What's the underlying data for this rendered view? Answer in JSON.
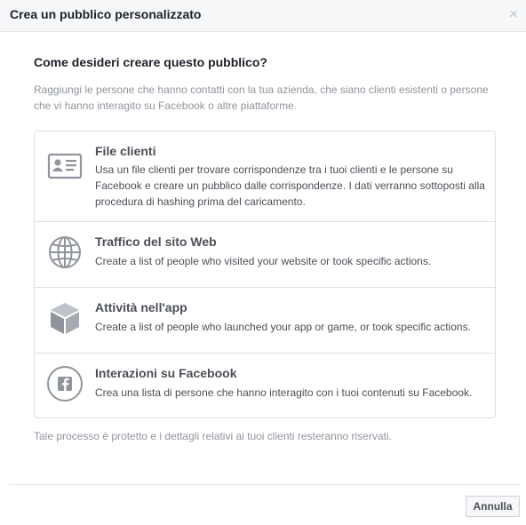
{
  "dialog": {
    "title": "Crea un pubblico personalizzato",
    "close_symbol": "×"
  },
  "intro": {
    "question": "Come desideri creare questo pubblico?",
    "description": "Raggiungi le persone che hanno contatti con la tua azienda, che siano clienti esistenti o persone che vi hanno interagito su Facebook o altre piattaforme."
  },
  "options": [
    {
      "title": "File clienti",
      "description": "Usa un file clienti per trovare corrispondenze tra i tuoi clienti e le persone su Facebook e creare un pubblico dalle corrispondenze. I dati verranno sottoposti alla procedura di hashing prima del caricamento.",
      "icon": "contact-card-icon"
    },
    {
      "title": "Traffico del sito Web",
      "description": "Create a list of people who visited your website or took specific actions.",
      "icon": "globe-icon"
    },
    {
      "title": "Attività nell'app",
      "description": "Create a list of people who launched your app or game, or took specific actions.",
      "icon": "cube-icon"
    },
    {
      "title": "Interazioni su Facebook",
      "description": "Crea una lista di persone che hanno interagito con i tuoi contenuti su Facebook.",
      "icon": "facebook-icon"
    }
  ],
  "footer": {
    "note": "Tale processo è protetto e i dettagli relativi ai tuoi clienti resteranno riservati.",
    "cancel_label": "Annulla"
  },
  "colors": {
    "icon_gray": "#90949c",
    "text_dark": "#1d2129",
    "text_muted": "#90949c",
    "border": "#dddfe2"
  }
}
